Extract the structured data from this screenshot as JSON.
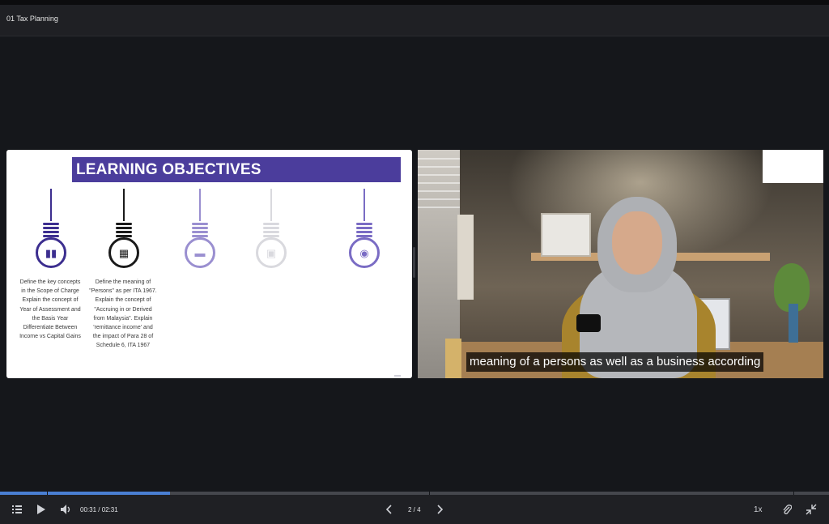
{
  "window": {
    "title": "01 Tax Planning"
  },
  "slide": {
    "heading": "LEARNING OBJECTIVES",
    "accent_color": "#4b3d9c",
    "bulbs": [
      {
        "icon": "book-icon",
        "color": "#3c2e8f",
        "text": "Define the key concepts\nin the Scope of Charge\nExplain the concept of\nYear of Assessment and\nthe Basis Year\nDifferentiate Between\nIncome vs Capital Gains"
      },
      {
        "icon": "calendar-icon",
        "color": "#1a1a1a",
        "text": "Define the meaning of\n\"Persons\" as per ITA 1967.\nExplain the concept of\n\"Accruing in or Derived\nfrom Malaysia\". Explain\n'remittance income' and\nthe impact of Para 28 of\nSchedule 6, ITA 1967"
      },
      {
        "icon": "car-icon",
        "color": "#9a8fd0",
        "text": ""
      },
      {
        "icon": "image-icon",
        "color": "#d9d9de",
        "text": ""
      },
      {
        "icon": "piggy-bank-icon",
        "color": "#7a6cc4",
        "text": ""
      }
    ]
  },
  "video": {
    "subtitle": "meaning of a persons as well as a business according"
  },
  "player": {
    "current_time": "00:31",
    "duration": "02:31",
    "time_display": "00:31 / 02:31",
    "progress_fraction": 0.205,
    "page_display": "2 / 4",
    "speed": "1x",
    "icons": {
      "chapters": "list-icon",
      "play": "play-icon",
      "volume": "volume-icon",
      "prev": "chevron-left-icon",
      "next": "chevron-right-icon",
      "attach": "paperclip-icon",
      "minimize": "collapse-icon"
    }
  }
}
